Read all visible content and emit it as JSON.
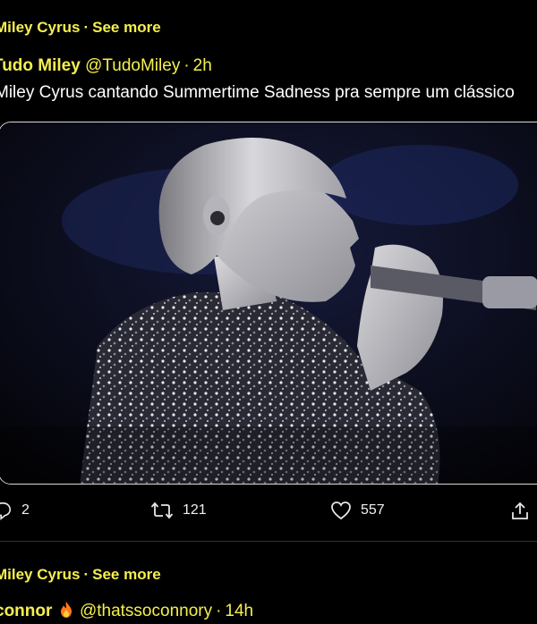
{
  "topic_1": {
    "name": "Miley Cyrus",
    "dot": "·",
    "see_more": "See more"
  },
  "tweet": {
    "author": "Tudo Miley",
    "handle": "@TudoMiley",
    "dot": "·",
    "time": "2h",
    "text": "Miley Cyrus cantando Summertime Sadness pra sempre um clássico",
    "replies": "2",
    "retweets": "121",
    "likes": "557"
  },
  "topic_2": {
    "name": "Miley Cyrus",
    "dot": "·",
    "see_more": "See more"
  },
  "next_tweet": {
    "author": "connor",
    "handle": "@thatssoconnory",
    "dot": "·",
    "time": "14h"
  },
  "icons": {
    "reply": "reply-icon",
    "retweet": "retweet-icon",
    "like": "heart-icon",
    "share": "share-icon",
    "emoji": "fire-emoji-icon"
  },
  "colors": {
    "accent": "#f5ef4f",
    "text": "#ffffff",
    "background": "#000000"
  }
}
